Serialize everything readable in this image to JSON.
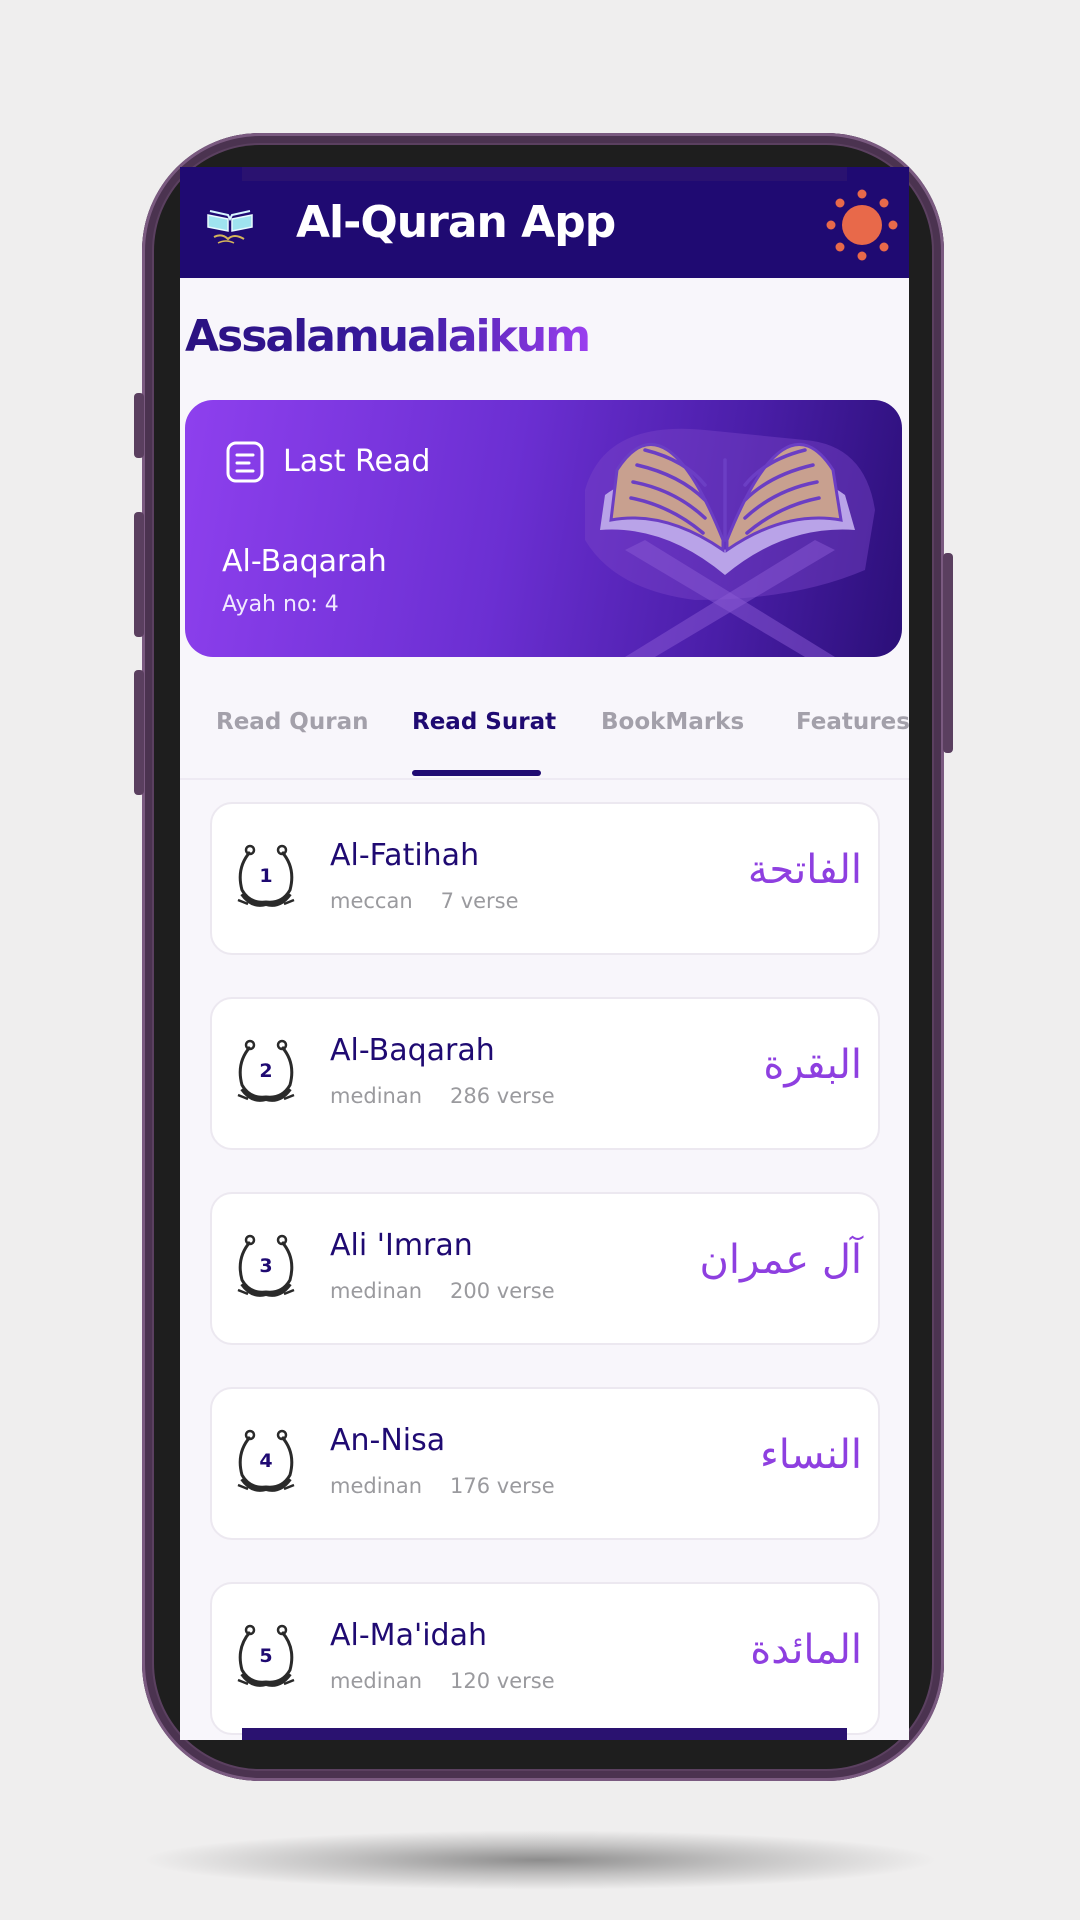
{
  "app": {
    "title": "Al-Quran App",
    "greeting": "Assalamualaikum"
  },
  "last_read": {
    "label": "Last Read",
    "surah": "Al-Baqarah",
    "ayah": "Ayah no: 4"
  },
  "tabs": [
    {
      "label": "Read Quran",
      "active": false
    },
    {
      "label": "Read Surat",
      "active": true
    },
    {
      "label": "BookMarks",
      "active": false
    },
    {
      "label": "Features",
      "active": false
    }
  ],
  "surahs": [
    {
      "number": "1",
      "name": "Al-Fatihah",
      "type": "meccan",
      "verses": "7 verse",
      "arabic": "الفاتحة"
    },
    {
      "number": "2",
      "name": "Al-Baqarah",
      "type": "medinan",
      "verses": "286 verse",
      "arabic": "البقرة"
    },
    {
      "number": "3",
      "name": "Ali 'Imran",
      "type": "medinan",
      "verses": "200 verse",
      "arabic": "آل عمران"
    },
    {
      "number": "4",
      "name": "An-Nisa",
      "type": "medinan",
      "verses": "176 verse",
      "arabic": "النساء"
    },
    {
      "number": "5",
      "name": "Al-Ma'idah",
      "type": "medinan",
      "verses": "120 verse",
      "arabic": "المائدة"
    }
  ],
  "colors": {
    "primary": "#1f0a72",
    "accent": "#8e3fe0",
    "sun": "#e8694a"
  },
  "icons": {
    "logo": "quran-logo-icon",
    "theme": "sun-icon",
    "last_read": "bookmark-icon",
    "badge": "ornament-number-icon"
  }
}
